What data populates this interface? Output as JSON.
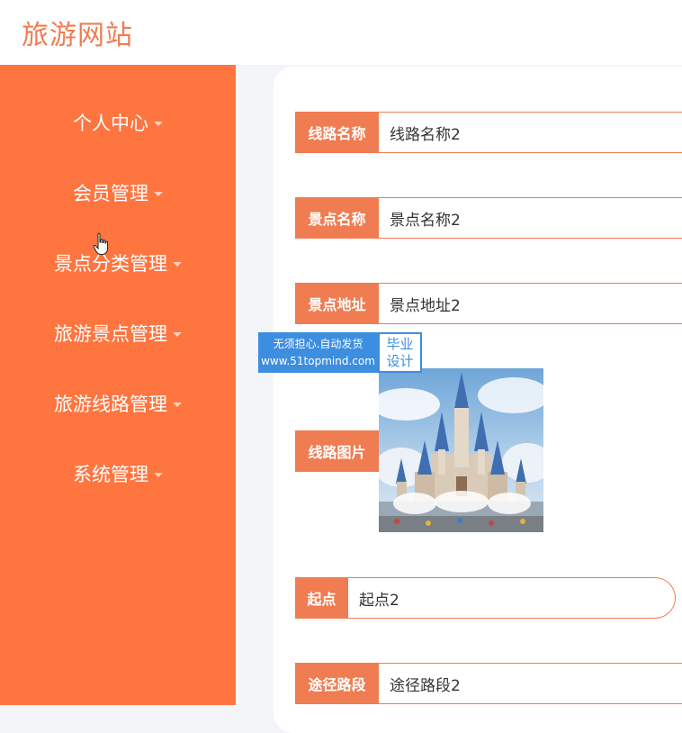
{
  "header": {
    "site_title": "旅游网站"
  },
  "sidebar": {
    "items": [
      {
        "label": "个人中心"
      },
      {
        "label": "会员管理"
      },
      {
        "label": "景点分类管理"
      },
      {
        "label": "旅游景点管理"
      },
      {
        "label": "旅游线路管理"
      },
      {
        "label": "系统管理"
      }
    ]
  },
  "form": {
    "route_name": {
      "label": "线路名称",
      "value": "线路名称2"
    },
    "spot_name": {
      "label": "景点名称",
      "value": "景点名称2"
    },
    "spot_address": {
      "label": "景点地址",
      "value": "景点地址2"
    },
    "route_image": {
      "label": "线路图片"
    },
    "start_point": {
      "label": "起点",
      "value": "起点2"
    },
    "route_segment": {
      "label": "途径路段",
      "value": "途径路段2"
    }
  },
  "watermark": {
    "line1": "无须担心.自动发货",
    "line2": "www.51topmind.com",
    "badge_line1": "毕业",
    "badge_line2": "设计"
  },
  "colors": {
    "accent": "#f07c52",
    "sidebar": "#ff7540",
    "watermark_blue": "#3d8ee0"
  }
}
